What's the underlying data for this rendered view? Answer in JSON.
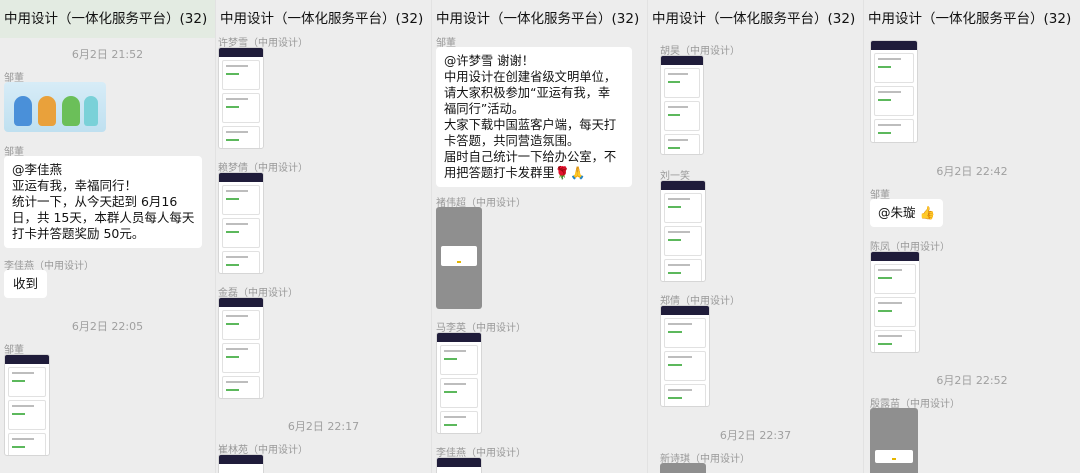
{
  "chat_title": "中用设计（一体化服务平台）(32)",
  "col1": {
    "time1": "6月2日 21:52",
    "sender1": "邹董",
    "sender2": "邹董",
    "message_lines": [
      "@李佳燕",
      "亚运有我，幸福同行！",
      "统计一下，从今天起到 6月16",
      "日，共 15天，本群人员每人每天",
      "打卡并答题奖励 50元。"
    ],
    "sender3": "李佳燕（中用设计）",
    "reply": "收到",
    "time2": "6月2日 22:05",
    "sender4": "邹董"
  },
  "col2": {
    "name1": "许梦雪（中用设计）",
    "name2": "赖梦倩（中用设计）",
    "name3": "金磊（中用设计）",
    "time1": "6月2日 22:17",
    "name4": "崔林苑（中用设计）"
  },
  "col3": {
    "sender1": "邹董",
    "message_lines": [
      "@许梦雪 谢谢！",
      "中用设计在创建省级文明单位，",
      "请大家积极参加“亚运有我，幸",
      "福同行”活动。",
      "大家下载中国蓝客户端，每天打",
      "卡答题，共同营造氛围。",
      "届时自己统计一下给办公室，不",
      "用把答题打卡发群里🌹🙏"
    ],
    "name2": "褚伟超（中用设计）",
    "name3": "马李英（中用设计）",
    "name4": "李佳燕（中用设计）"
  },
  "col4": {
    "name1": "胡昊（中用设计）",
    "name2": "刘一笑",
    "name3": "郑倩（中用设计）",
    "time1": "6月2日 22:37",
    "name4": "新诗琪（中用设计）"
  },
  "col5": {
    "time1": "6月2日 22:42",
    "sender1": "邹董",
    "reply": "@朱璇 👍",
    "name2": "陈凤（中用设计）",
    "time2": "6月2日 22:52",
    "name3": "殷露苗（中用设计）"
  }
}
